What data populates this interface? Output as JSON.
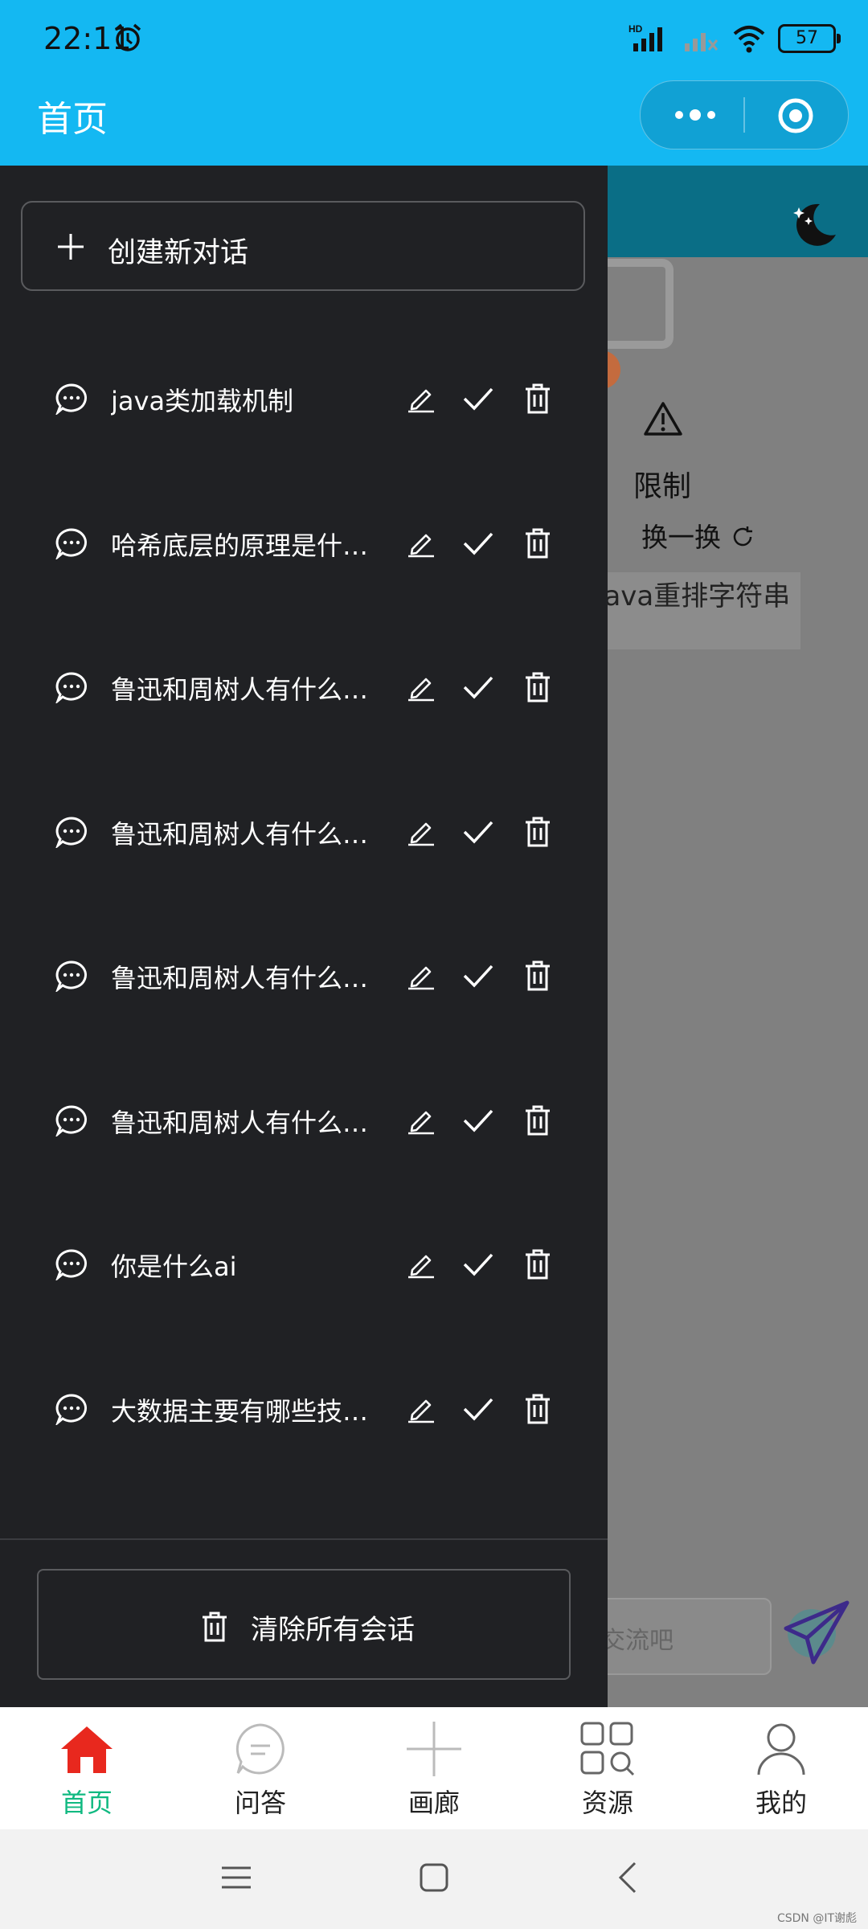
{
  "status_bar": {
    "time": "22:11",
    "battery": "57",
    "network_badge": "HD"
  },
  "header": {
    "title": "首页"
  },
  "background_page": {
    "limit_text": "限制",
    "refresh_text": "换一换",
    "example_text": "java重排字符串",
    "input_placeholder": "交流吧"
  },
  "drawer": {
    "new_chat_label": "创建新对话",
    "conversations": [
      {
        "title": "java类加载机制"
      },
      {
        "title": "哈希底层的原理是什…"
      },
      {
        "title": "鲁迅和周树人有什么…"
      },
      {
        "title": "鲁迅和周树人有什么…"
      },
      {
        "title": "鲁迅和周树人有什么…"
      },
      {
        "title": "鲁迅和周树人有什么…"
      },
      {
        "title": "你是什么ai"
      },
      {
        "title": "大数据主要有哪些技…"
      }
    ],
    "clear_label": "清除所有会话"
  },
  "tabbar": {
    "items": [
      {
        "label": "首页",
        "icon": "home-icon",
        "active": true
      },
      {
        "label": "问答",
        "icon": "chat-bubble-icon",
        "active": false
      },
      {
        "label": "画廊",
        "icon": "plus-icon",
        "active": false
      },
      {
        "label": "资源",
        "icon": "grid-search-icon",
        "active": false
      },
      {
        "label": "我的",
        "icon": "person-icon",
        "active": false
      }
    ]
  },
  "colors": {
    "header": "#14b8f2",
    "drawer": "#202124",
    "active_tab": "#10b981",
    "home_icon": "#e8281e"
  },
  "watermark": "CSDN @IT谢彪"
}
